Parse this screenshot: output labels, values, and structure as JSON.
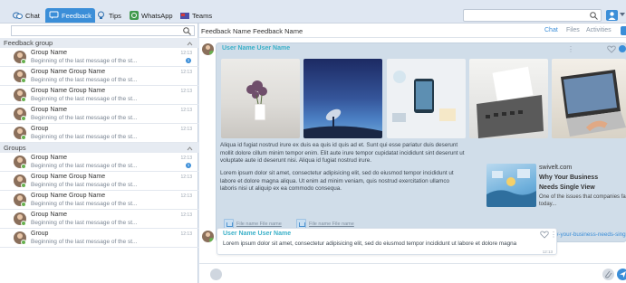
{
  "tabs": [
    {
      "label": "Chat",
      "icon": "chat-icon"
    },
    {
      "label": "Feedback",
      "icon": "feedback-icon"
    },
    {
      "label": "Tips",
      "icon": "lightbulb-icon"
    },
    {
      "label": "WhatsApp",
      "icon": "whatsapp-icon"
    },
    {
      "label": "Teams",
      "icon": "teams-icon"
    }
  ],
  "active_tab": "Feedback",
  "search": {
    "placeholder": ""
  },
  "sidebar": {
    "sections": [
      {
        "title": "Feedback group",
        "items": [
          {
            "name": "Group Name",
            "msg": "Beginning of the last message of the st...",
            "time": "12:13",
            "unread": "1"
          },
          {
            "name": "Group Name Group Name",
            "msg": "Beginning of the last message of the st...",
            "time": "12:13",
            "unread": ""
          },
          {
            "name": "Group Name Group Name",
            "msg": "Beginning of the last message of the st...",
            "time": "12:13",
            "unread": ""
          },
          {
            "name": "Group Name",
            "msg": "Beginning of the last message of the st...",
            "time": "12:13",
            "unread": ""
          },
          {
            "name": "Group",
            "msg": "Beginning of the last message of the st...",
            "time": "12:13",
            "unread": ""
          }
        ]
      },
      {
        "title": "Groups",
        "items": [
          {
            "name": "Group Name",
            "msg": "Beginning of the last message of the st...",
            "time": "12:13",
            "unread": "1"
          },
          {
            "name": "Group Name Group Name",
            "msg": "Beginning of the last message of the st...",
            "time": "12:13",
            "unread": ""
          },
          {
            "name": "Group Name Group Name",
            "msg": "Beginning of the last message of the st...",
            "time": "12:13",
            "unread": ""
          },
          {
            "name": "Group Name",
            "msg": "Beginning of the last message of the st...",
            "time": "12:13",
            "unread": ""
          },
          {
            "name": "Group",
            "msg": "Beginning of the last message of the st...",
            "time": "12:13",
            "unread": ""
          }
        ]
      }
    ]
  },
  "main": {
    "title": "Feedback Name Feedback Name",
    "tabs": [
      "Chat",
      "Files",
      "Activities"
    ],
    "message1": {
      "user": "User Name User Name",
      "para1": "Aliqua id fugiat nostrud irure ex duis ea quis id quis ad et. Sunt qui esse pariatur duis deserunt mollit dolore cillum minim tempor enim. Elit aute irure tempor cupidatat incididunt sint deserunt ut voluptate aute id deserunt nisi. Aliqua id fugiat nostrud irure.",
      "para2": "Lorem ipsum dolor sit amet, consectetur adipisicing elit, sed do eiusmod tempor incididunt ut labore et dolore magna aliqua. Ut enim ad minim veniam, quis nostrud exercitation ullamco laboris nisi ut aliquip ex ea commodo consequa.",
      "files": [
        "File name File name",
        "File name File name"
      ],
      "link_preview": {
        "domain": "swivelt.com",
        "title": "Why Your Business",
        "subtitle": "Needs Single View",
        "desc": "One of the issues that companies face today...",
        "url": "https://www.swivelt.com/why-your-business-needs-single-view/"
      }
    },
    "message2": {
      "user": "User Name User Name",
      "text": "Lorem ipsum dolor sit amet, consectetur adipisicing elit, sed do eiusmod tempor incididunt ut labore et dolore magna",
      "time": "12:13"
    }
  },
  "colors": {
    "accent": "#3b8ed8",
    "username": "#3ab0c8",
    "highlight_bubble": "#d0dde9"
  }
}
